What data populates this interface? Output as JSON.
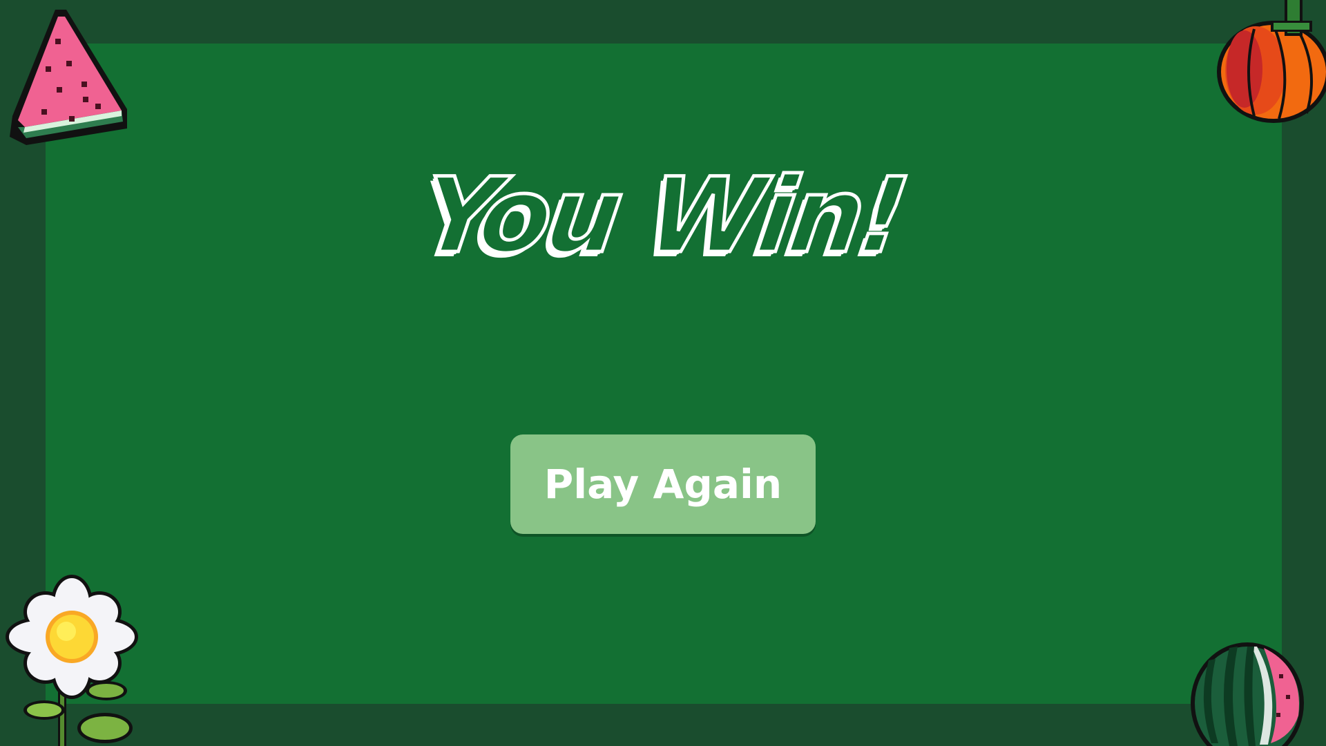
{
  "title": "You Win!",
  "play_again_label": "Play Again",
  "colors": {
    "outer_border": "#1a4d2e",
    "board": "#137033",
    "button": "#89c487",
    "text": "#ffffff"
  },
  "decorations": [
    "watermelon-slice-icon",
    "pumpkin-icon",
    "daisy-flower-icon",
    "watermelon-icon"
  ]
}
